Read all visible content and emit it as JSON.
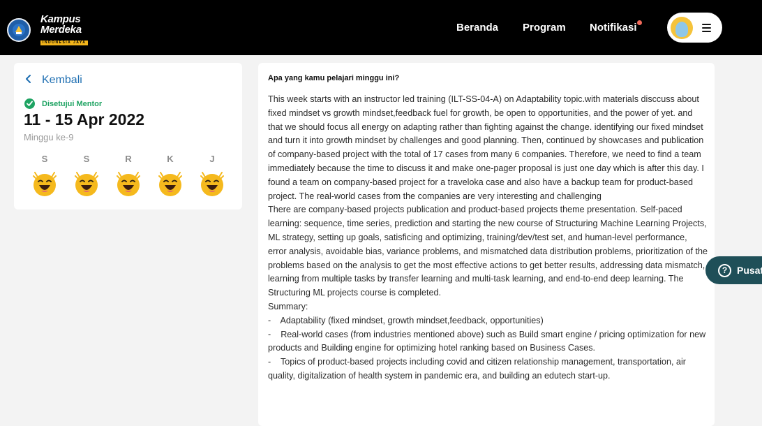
{
  "header": {
    "brand_line1": "Kampus",
    "brand_line2": "Merdeka",
    "brand_tagline": "INDONESIA JAYA",
    "nav": [
      "Beranda",
      "Program",
      "Notifikasi"
    ],
    "notification_dot_color": "#f26a5a"
  },
  "sidebar": {
    "back_label": "Kembali",
    "status": "Disetujui Mentor",
    "date_range": "11 - 15 Apr 2022",
    "week": "Minggu ke-9",
    "days": [
      "S",
      "S",
      "R",
      "K",
      "J"
    ],
    "mood_icon": "laughing-face-icon"
  },
  "report": {
    "question": "Apa yang kamu pelajari minggu ini?",
    "answer": "This week starts with an instructor led training (ILT-SS-04-A) on Adaptability topic.with materials disccuss about fixed mindset vs growth mindset,feedback fuel for growth, be open to opportunities, and the power of yet. and that we should focus all energy on adapting rather than fighting against the change. identifying our fixed mindset and turn it into growth mindset by challenges and good planning. Then, continued by showcases and publication of company-based project with the total of 17 cases from many 6 companies. Therefore, we need to find a team immediately because the time to discuss it and make one-pager proposal is just one day which is after this day. I found a team on company-based project for a traveloka case and also have a backup team for product-based project. The real-world cases from the companies are very interesting and challenging\nThere are company-based projects publication and product-based projects theme presentation. Self-paced learning: sequence, time series, prediction and starting the new course of Structuring Machine Learning Projects, ML strategy, setting up goals, satisficing and optimizing, training/dev/test set, and human-level performance, error analysis, avoidable bias, variance problems, and mismatched data distribution problems, prioritization of the problems based on the analysis to get the most effective actions to get better results, addressing data mismatch, learning from multiple tasks by transfer learning and multi-task learning, and end-to-end deep learning. The Structuring ML projects course is completed.\nSummary:\n-    Adaptability (fixed mindset, growth mindset,feedback, opportunities)\n-    Real-world cases (from industries mentioned above) such as Build smart engine / pricing optimization for new products and Building engine for optimizing hotel ranking based on Business Cases.\n-    Topics of product-based projects including covid and citizen relationship management, transportation, air quality, digitalization of health system in pandemic era, and building an edutech start-up."
  },
  "help": {
    "label": "Pusat"
  },
  "colors": {
    "header_bg": "#000000",
    "accent_blue": "#1f6fb2",
    "approved_green": "#1ea362",
    "help_pill": "#1f4f58",
    "emoji_yellow": "#f5b91d"
  }
}
